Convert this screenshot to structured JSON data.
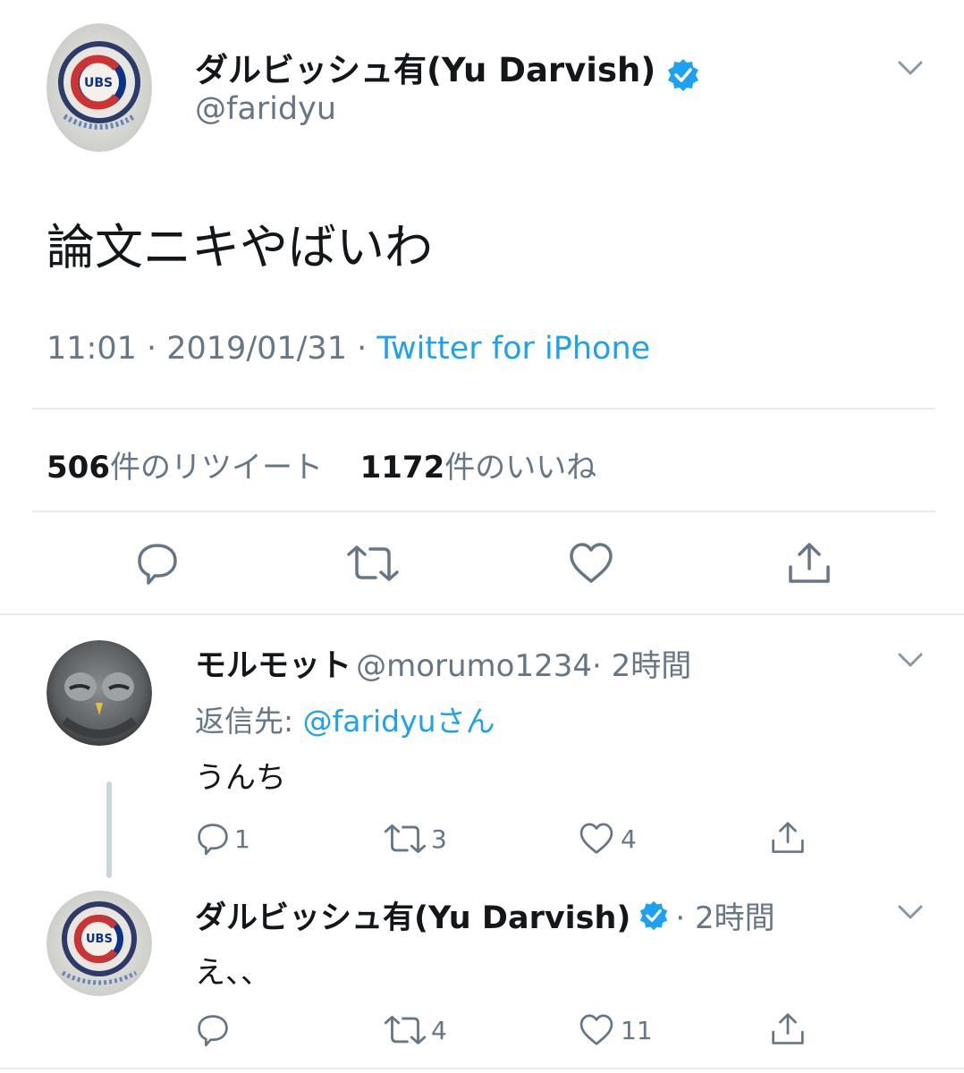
{
  "main_tweet": {
    "display_name": "ダルビッシュ有(Yu Darvish)",
    "handle": "@faridyu",
    "text": "論文ニキやばいわ",
    "time": "11:01 · 2019/01/31 · ",
    "source": "Twitter for iPhone",
    "retweet_count": "506",
    "retweet_label": "件のリツイート",
    "like_count": "1172",
    "like_label": "件のいいね",
    "avatar_logo_text": "UBS"
  },
  "replies": [
    {
      "display_name": "モルモット",
      "handle": "@morumo1234",
      "time": "· 2時間",
      "reply_to_prefix": "返信先: ",
      "reply_to_handle": "@faridyuさん",
      "text": "うんち",
      "reply_count": "1",
      "retweet_count": "3",
      "like_count": "4"
    },
    {
      "display_name": "ダルビッシュ有(Yu Darvish)",
      "time": "· 2時間",
      "text": "え、、",
      "reply_count": "",
      "retweet_count": "4",
      "like_count": "11",
      "avatar_logo_text": "UBS"
    }
  ],
  "colors": {
    "accent": "#1da1f2",
    "text": "#14171a",
    "secondary": "#657786",
    "divider": "#e6ecf0",
    "cubs_blue": "#0e3386",
    "cubs_red": "#cc3433"
  }
}
